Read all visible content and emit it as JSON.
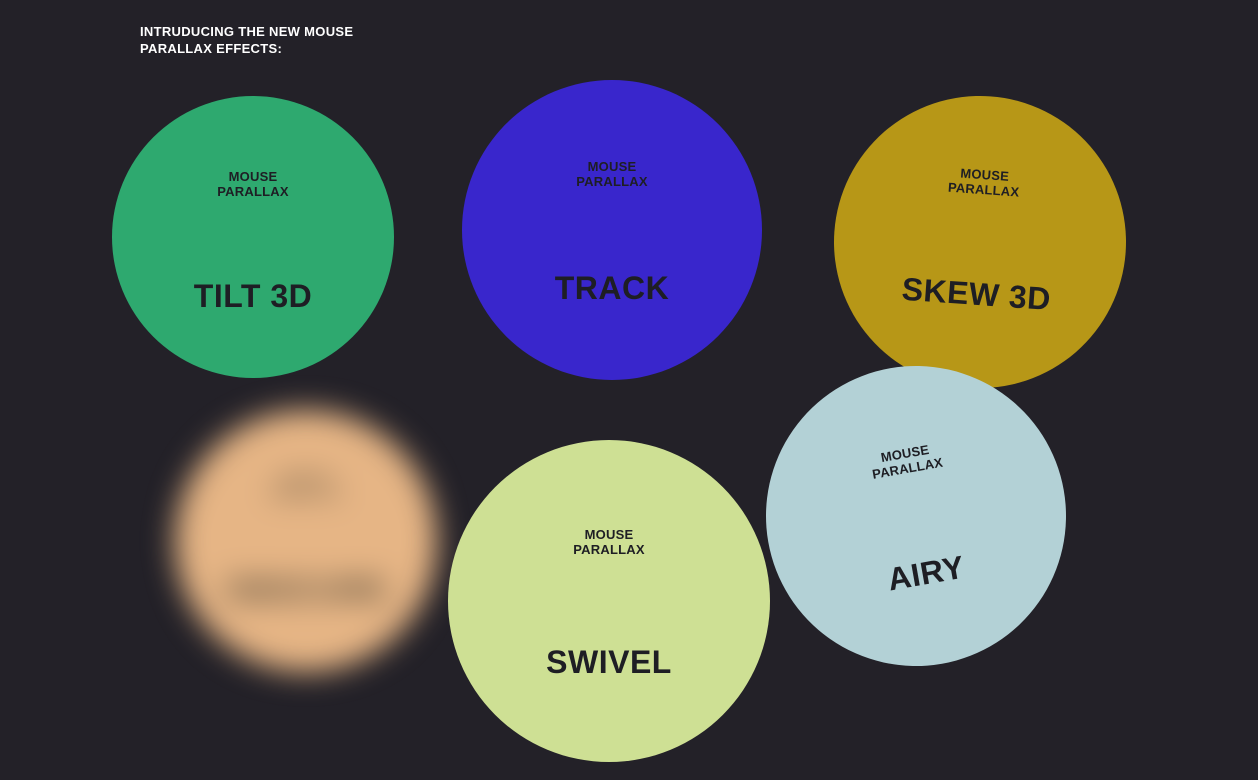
{
  "header": {
    "line1": "INTRUDUCING THE NEW MOUSE",
    "line2": "PARALLAX EFFECTS:"
  },
  "circles": {
    "tilt3d": {
      "label_line1": "MOUSE",
      "label_line2": "PARALLAX",
      "name": "TILT 3D",
      "color": "#2ea96f"
    },
    "track": {
      "label_line1": "MOUSE",
      "label_line2": "PARALLAX",
      "name": "TRACK",
      "color": "#3926cc"
    },
    "skew3d": {
      "label_line1": "MOUSE",
      "label_line2": "PARALLAX",
      "name": "SKEW 3D",
      "color": "#b79717"
    },
    "obscure": {
      "label_line1": "MOUSE",
      "label_line2": "PARALLAX",
      "name": "OBSCURE",
      "color": "#e6b585"
    },
    "swivel": {
      "label_line1": "MOUSE",
      "label_line2": "PARALLAX",
      "name": "SWIVEL",
      "color": "#cee094"
    },
    "airy": {
      "label_line1": "MOUSE",
      "label_line2": "PARALLAX",
      "name": "AIRY",
      "color": "#b3d1d6"
    }
  }
}
